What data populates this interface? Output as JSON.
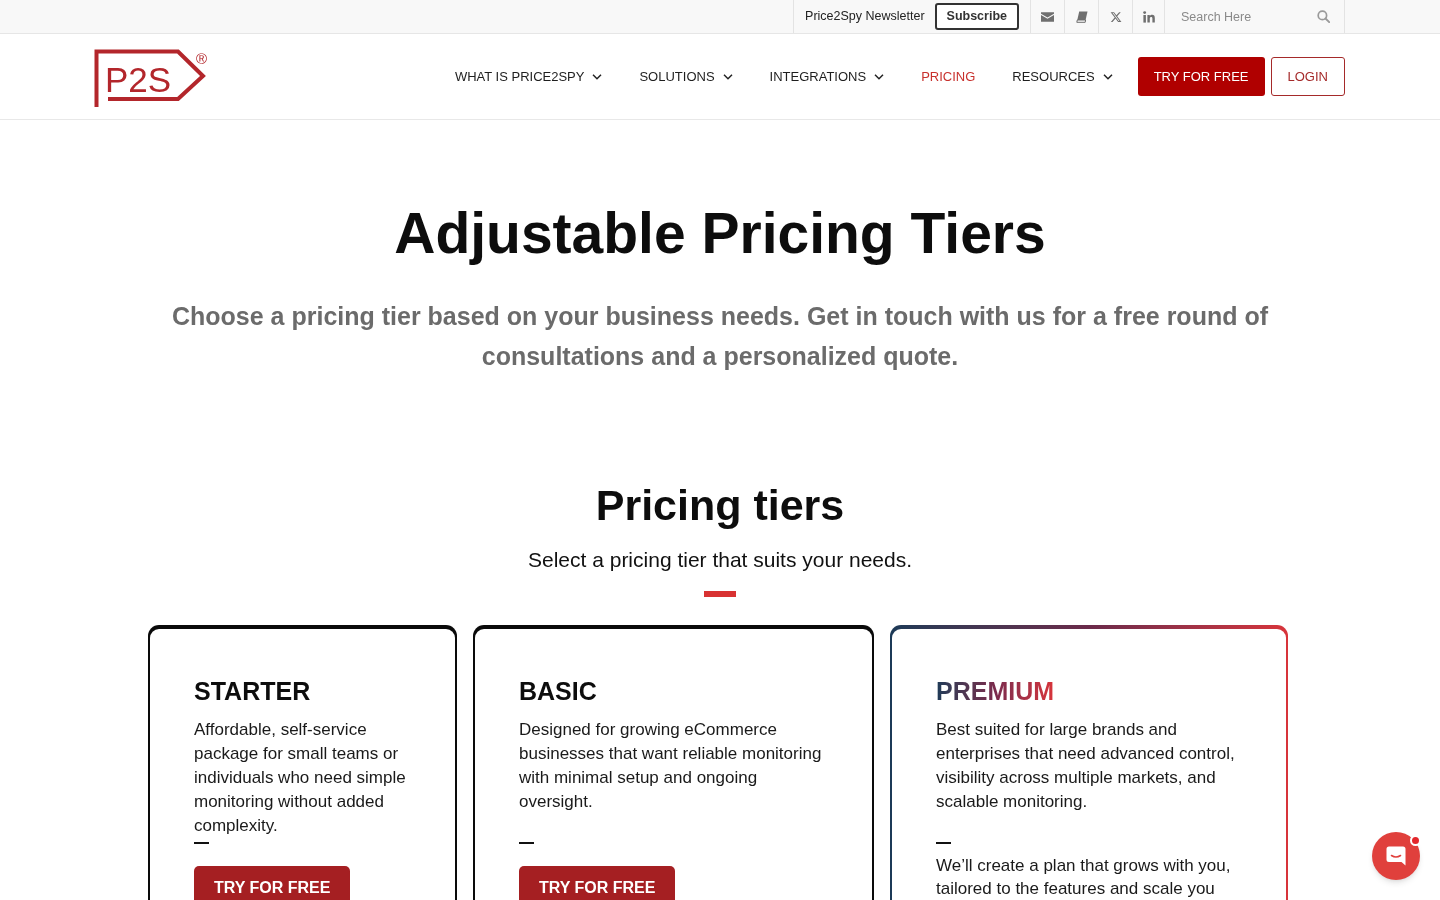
{
  "top_bar": {
    "newsletter_label": "Price2Spy Newsletter",
    "subscribe_button": "Subscribe",
    "search": {
      "placeholder": "Search Here"
    }
  },
  "logo": {
    "text": "P2S",
    "mark": "®"
  },
  "nav": {
    "items": [
      {
        "label": "WHAT IS PRICE2SPY",
        "has_dropdown": true,
        "selected": false
      },
      {
        "label": "SOLUTIONS",
        "has_dropdown": true,
        "selected": false
      },
      {
        "label": "INTEGRATIONS",
        "has_dropdown": true,
        "selected": false
      },
      {
        "label": "PRICING",
        "has_dropdown": false,
        "selected": true
      },
      {
        "label": "RESOURCES",
        "has_dropdown": true,
        "selected": false
      }
    ],
    "buttons": [
      {
        "label": "TRY FOR FREE",
        "kind": "trial"
      },
      {
        "label": "LOGIN",
        "kind": "login"
      }
    ]
  },
  "hero": {
    "title": "Adjustable Pricing Tiers",
    "subtitle": "Choose a pricing tier based on your business needs. Get in touch with us for a free round of consultations and a personalized quote."
  },
  "pricing": {
    "title": "Pricing tiers",
    "subtitle": "Select a pricing tier that suits your needs.",
    "tiers": [
      {
        "name": "STARTER",
        "featured": false,
        "description": "Affordable, self-service package for small teams or individuals who need simple monitoring without added complexity.",
        "button": "TRY FOR FREE"
      },
      {
        "name": "BASIC",
        "featured": false,
        "description": "Designed for growing eCommerce businesses that want reliable monitoring with minimal setup and ongoing oversight.",
        "button": "TRY FOR FREE"
      },
      {
        "name": "PREMIUM",
        "featured": true,
        "description": "Best suited for large brands and enterprises that need advanced control, visibility across multiple markets, and scalable monitoring.",
        "note": "We’ll create a plan that grows with you, tailored to the features and scale you"
      }
    ]
  },
  "chat_widget": {
    "unread": true
  }
}
